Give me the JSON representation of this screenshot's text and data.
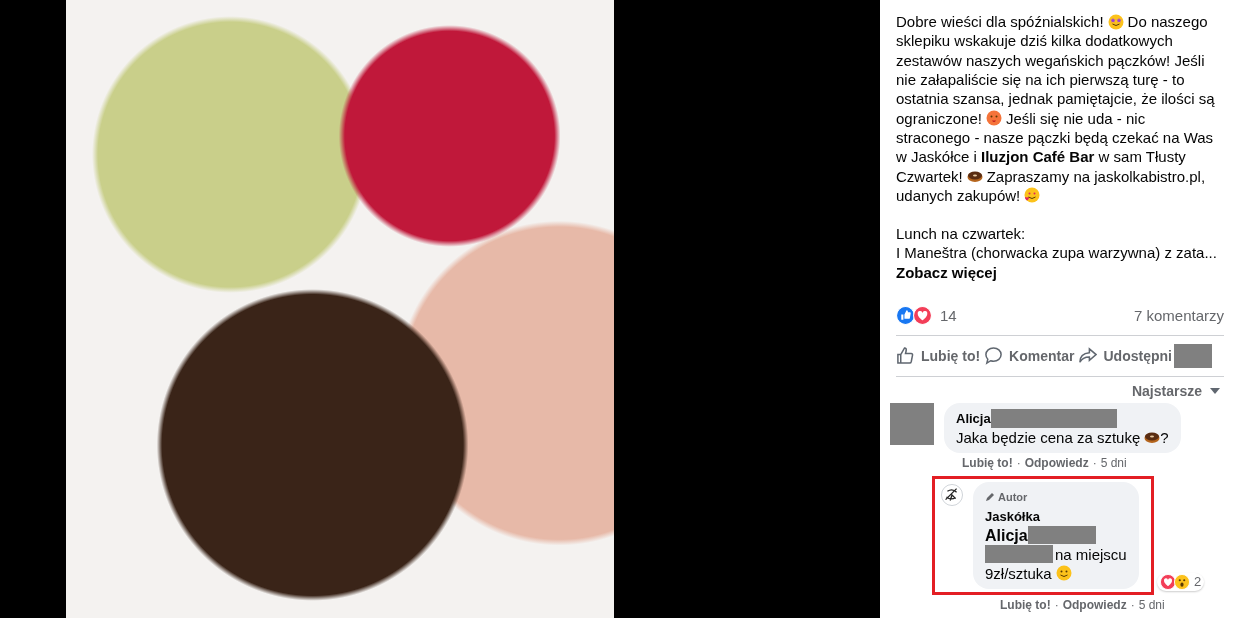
{
  "post": {
    "lines": [
      [
        {
          "kind": "text",
          "text": "Dobre wieści dla spóźnialskich!"
        },
        {
          "kind": "starstruck"
        },
        {
          "kind": "text",
          "text": "Do naszego"
        }
      ],
      [
        {
          "kind": "text",
          "text": "sklepiku wskakuje dziś kilka dodatkowych"
        }
      ],
      [
        {
          "kind": "text",
          "text": "zestawów naszych wegańskich pączków! Jeśli"
        }
      ],
      [
        {
          "kind": "text",
          "text": "nie załapaliście się na ich pierwszą turę - to"
        }
      ],
      [
        {
          "kind": "text",
          "text": "ostatnia szansa, jednak pamiętajcie, że ilości są"
        }
      ],
      [
        {
          "kind": "text",
          "text": "ograniczone!"
        },
        {
          "kind": "hotface"
        },
        {
          "kind": "text",
          "text": "Jeśli się nie uda - nic"
        }
      ],
      [
        {
          "kind": "text",
          "text": "straconego - nasze pączki będą czekać na Was"
        }
      ],
      [
        {
          "kind": "text",
          "text": "w Jaskółce i **Iluzjon Café Bar** w sam Tłusty"
        }
      ],
      [
        {
          "kind": "text",
          "text": "Czwartek!"
        },
        {
          "kind": "donut"
        },
        {
          "kind": "text",
          "text": "Zapraszamy na jaskolkabistro.pl,"
        }
      ],
      [
        {
          "kind": "text",
          "text": "udanych zakupów!"
        },
        {
          "kind": "hearts"
        }
      ]
    ],
    "lunch_heading": "Lunch na czwartek:",
    "lunch_line": "I Maneštra (chorwacka zupa warzywna) z zata...",
    "see_more": "Zobacz więcej"
  },
  "reactions": {
    "icons": [
      {
        "kind": "like"
      },
      {
        "kind": "love"
      }
    ],
    "count": "14",
    "comments": "7 komentarzy"
  },
  "actions": [
    {
      "kind": "like",
      "label": "Lubię to!",
      "redacted": false
    },
    {
      "kind": "comment",
      "label": "Komentar",
      "redacted": false
    },
    {
      "kind": "share",
      "label": "Udostępni",
      "redacted": true
    }
  ],
  "sort": {
    "label": "Najstarsze"
  },
  "comments": [
    {
      "highlighted": false,
      "avatar": {
        "kind": "redacted"
      },
      "author": "Alicja",
      "author_redacted": true,
      "lines": [
        [
          {
            "kind": "text",
            "text": "Jaka będzie cena za sztukę"
          },
          {
            "kind": "donut"
          },
          {
            "kind": "text",
            "text": "?"
          }
        ]
      ],
      "meta": [
        {
          "kind": "link",
          "text": "Lubię to!"
        },
        {
          "kind": "sep",
          "text": "·"
        },
        {
          "kind": "link",
          "text": "Odpowiedz"
        },
        {
          "kind": "sep",
          "text": "·"
        },
        {
          "kind": "time",
          "text": "5 dni"
        }
      ]
    },
    {
      "highlighted": true,
      "avatar": {
        "kind": "logo"
      },
      "badge": "Autor",
      "author": "Jaskółka",
      "author_redacted": false,
      "lines": [
        [
          {
            "kind": "mention",
            "text": "Alicja"
          },
          {
            "kind": "redacted"
          }
        ],
        [
          {
            "kind": "redacted"
          },
          {
            "kind": "text",
            "text": "na miejscu"
          }
        ],
        [
          {
            "kind": "text",
            "text": "9zł/sztuka"
          },
          {
            "kind": "smile"
          }
        ]
      ],
      "reactions": {
        "icons": [
          {
            "kind": "love"
          },
          {
            "kind": "wow"
          }
        ],
        "count": "2"
      },
      "meta": [
        {
          "kind": "link",
          "text": "Lubię to!"
        },
        {
          "kind": "sep",
          "text": "·"
        },
        {
          "kind": "link",
          "text": "Odpowiedz"
        },
        {
          "kind": "sep",
          "text": "·"
        },
        {
          "kind": "time",
          "text": "5 dni"
        }
      ]
    }
  ]
}
